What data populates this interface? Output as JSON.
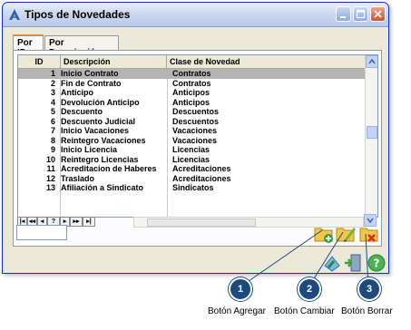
{
  "window": {
    "title": "Tipos de Novedades",
    "controls": [
      "minimize-icon",
      "maximize-icon",
      "close-icon"
    ]
  },
  "tabs": [
    {
      "label": "Por ID",
      "active": true
    },
    {
      "label": "Por Descripción",
      "active": false
    }
  ],
  "grid": {
    "columns": [
      "ID",
      "Descripción",
      "Clase de Novedad"
    ],
    "rows": [
      {
        "id": "1",
        "descripcion": "Inicio Contrato",
        "clase": "Contratos",
        "selected": true
      },
      {
        "id": "2",
        "descripcion": "Fin de Contrato",
        "clase": "Contratos"
      },
      {
        "id": "3",
        "descripcion": "Anticipo",
        "clase": "Anticipos"
      },
      {
        "id": "4",
        "descripcion": "Devolución Anticipo",
        "clase": "Anticipos"
      },
      {
        "id": "5",
        "descripcion": "Descuento",
        "clase": "Descuentos"
      },
      {
        "id": "6",
        "descripcion": "Descuento Judicial",
        "clase": "Descuentos"
      },
      {
        "id": "7",
        "descripcion": "Inicio Vacaciones",
        "clase": "Vacaciones"
      },
      {
        "id": "8",
        "descripcion": "Reintegro Vacaciones",
        "clase": "Vacaciones"
      },
      {
        "id": "9",
        "descripcion": "Inicio Licencia",
        "clase": "Licencias"
      },
      {
        "id": "10",
        "descripcion": "Reintegro Licencias",
        "clase": "Licencias"
      },
      {
        "id": "11",
        "descripcion": "Acreditacion de Haberes",
        "clase": "Acreditaciones"
      },
      {
        "id": "12",
        "descripcion": "Traslado",
        "clase": "Acreditaciones"
      },
      {
        "id": "13",
        "descripcion": "Afiliación a Sindicato",
        "clase": "Sindicatos"
      }
    ]
  },
  "navigator": [
    "|◂",
    "◂◂",
    "◂",
    "?",
    "▸",
    "▸▸",
    "▸|"
  ],
  "search": {
    "value": ""
  },
  "actions": {
    "add_icon": "folder-add-icon",
    "edit_icon": "folder-edit-icon",
    "delete_icon": "folder-delete-icon",
    "print_icon": "printer-icon",
    "exit_icon": "exit-door-icon",
    "help_icon": "help-icon"
  },
  "callouts": [
    {
      "number": "1",
      "label": "Botón Agregar"
    },
    {
      "number": "2",
      "label": "Botón Cambiar"
    },
    {
      "number": "3",
      "label": "Botón Borrar"
    }
  ],
  "colors": {
    "titlebar": "#cdd9ef",
    "selected_row": "#b4b4b4",
    "callout": "#1c4a7e",
    "close_button": "#d6502e"
  }
}
